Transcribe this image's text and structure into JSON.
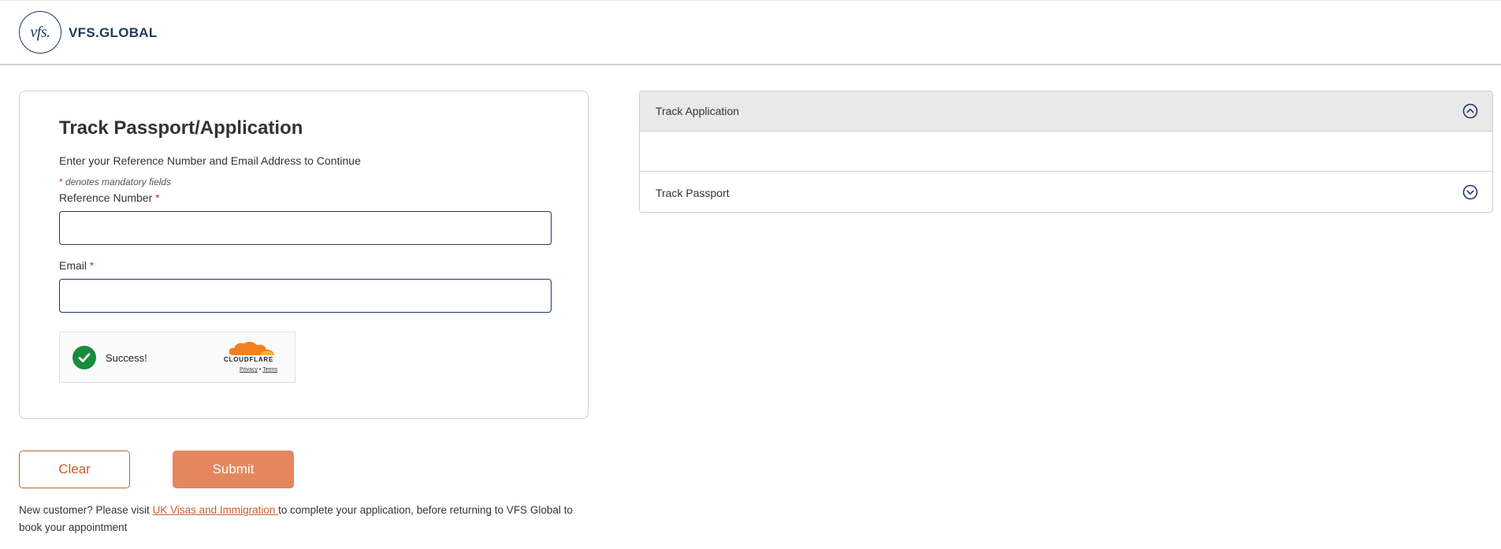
{
  "header": {
    "logo_mark": "vfs.",
    "logo_text": "VFS.GLOBAL"
  },
  "form": {
    "title": "Track Passport/Application",
    "intro": "Enter your Reference Number and Email Address to Continue",
    "mandatory_star": "*",
    "mandatory_note": "denotes mandatory fields",
    "reference_label": "Reference Number",
    "reference_value": "",
    "email_label": "Email",
    "email_value": "",
    "required_marker": "*"
  },
  "captcha": {
    "status": "Success!",
    "brand": "CLOUDFLARE",
    "privacy": "Privacy",
    "separator": "•",
    "terms": "Terms",
    "check_color": "#1a8a3b",
    "brand_color": "#f38020"
  },
  "buttons": {
    "clear_label": "Clear",
    "submit_label": "Submit"
  },
  "footer": {
    "text_before": "New customer? Please visit ",
    "link_text": "UK Visas and Immigration ",
    "text_after": "to complete your application, before returning to VFS Global to book your appointment"
  },
  "accordion": {
    "items": [
      {
        "label": "Track Application",
        "expanded": true,
        "icon": "chevron-up-circle-icon"
      },
      {
        "label": "Track Passport",
        "expanded": false,
        "icon": "chevron-down-circle-icon"
      }
    ]
  },
  "colors": {
    "navy": "#1e3a5f",
    "accent": "#c4612c",
    "submit_bg": "#e5875e",
    "required": "#c0392b"
  }
}
